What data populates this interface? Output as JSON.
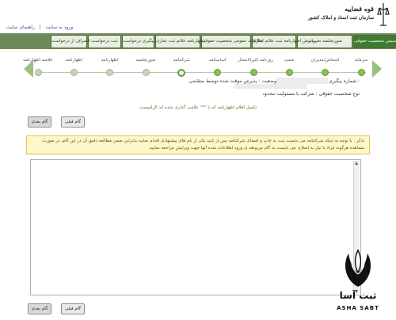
{
  "header": {
    "links": [
      "ورود به سایت",
      "راهنمای سایت"
    ],
    "logo_title": "قوه قضاییه",
    "logo_subtitle": "سازمان ثبت اسناد و املاک کشور"
  },
  "nav": {
    "tabs": [
      {
        "label": "تاسیس شخصیت حقوقی",
        "active": true
      },
      {
        "label": "صورتجلسه تغییرات",
        "active": false
      },
      {
        "label": "پذیرش اظهارنامه ثبت علائم تجاری",
        "active": false
      },
      {
        "label": "اطلاعات عمومی شخصیت حقوقی",
        "active": false
      },
      {
        "label": "اظهارنامه علائم ثبت تجاری",
        "active": false
      },
      {
        "label": "پیگیری درخواست",
        "active": false
      },
      {
        "label": "ثبت درخواست",
        "active": false
      },
      {
        "label": "انصراف از درخواست",
        "active": false
      }
    ]
  },
  "steps": [
    {
      "label": "سرمایه",
      "state": "done"
    },
    {
      "label": "اشخاص/مدیران",
      "state": "done"
    },
    {
      "label": "شعب",
      "state": "done"
    },
    {
      "label": "روزنامه کثیرالانتشار",
      "state": "done"
    },
    {
      "label": "اساسنامه",
      "state": "done"
    },
    {
      "label": "شرکتنامه",
      "state": "current"
    },
    {
      "label": "صورتجلسه",
      "state": "todo"
    },
    {
      "label": "اظهارنامه",
      "state": "todo"
    },
    {
      "label": "اظهارنامه",
      "state": "todo"
    },
    {
      "label": "خلاصه اظهارنامه",
      "state": "todo"
    }
  ],
  "info": {
    "tracking_label": "شماره پیگیری :",
    "status_text": "وضعیت : پذیرش موقت شده توسط متقاضی",
    "entity_type": "نوع شخصیت حقوقی : شرکت با مسئولیت محدود",
    "required_note": "تکمیل اقلام اظهارنامه که با \"*\" علامت گذاری شده اند الزامیست"
  },
  "buttons": {
    "prev": "گام قبلی",
    "next": "گام بعدی"
  },
  "warning": {
    "text": "تذکر : با توجه به اینکه شرکتنامه می بایست ثبت به چاپ و امضای شرکتنامه پس از تایید یکی از نام های پیشنهادی اقدام نمایید بنابراین ضمن مطالعه دقیق آن در این گام، در صورت مشاهده هرگونه ایراد با نیاز به اصلاح، می بایست به گام مربوطه ی ورود اطلاعات شده آنها جهت ویرایش مراجعه نمایید."
  },
  "watermark": {
    "brand": "ثبت آسا",
    "brand_en": "ASHA SABT"
  }
}
